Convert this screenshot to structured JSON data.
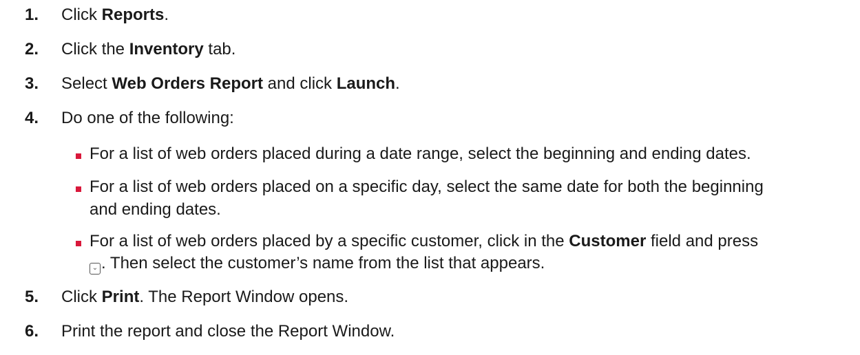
{
  "steps": [
    {
      "num": "1.",
      "pre": "Click ",
      "bold": "Reports",
      "post": "."
    },
    {
      "num": "2.",
      "pre": "Click the ",
      "bold": "Inventory",
      "post": " tab."
    },
    {
      "num": "3.",
      "pre": "Select ",
      "bold": "Web Orders Report",
      "mid": " and click ",
      "bold2": "Launch",
      "post": "."
    },
    {
      "num": "4.",
      "text": "Do one of the following:"
    },
    {
      "num": "5.",
      "pre": "Click ",
      "bold": "Print",
      "post": ". The Report Window opens."
    },
    {
      "num": "6.",
      "text": "Print the report and close the Report Window."
    }
  ],
  "bullets": {
    "b1": "For a list of web orders placed during a date range, select the beginning and ending dates.",
    "b2_line1": "For a list of web orders placed on a specific day, select the same date for both the beginning",
    "b2_line2": "and ending dates.",
    "b3_pre": "For a list of web orders placed by a specific customer, click in the ",
    "b3_bold": "Customer",
    "b3_post": " field and press",
    "b3_line2": ". Then select the customer’s name from the list that appears."
  },
  "icons": {
    "bullet": "red-square-bullet",
    "key": "lookup-key-icon"
  },
  "colors": {
    "text": "#1a1a1a",
    "bullet": "#d9183b"
  }
}
